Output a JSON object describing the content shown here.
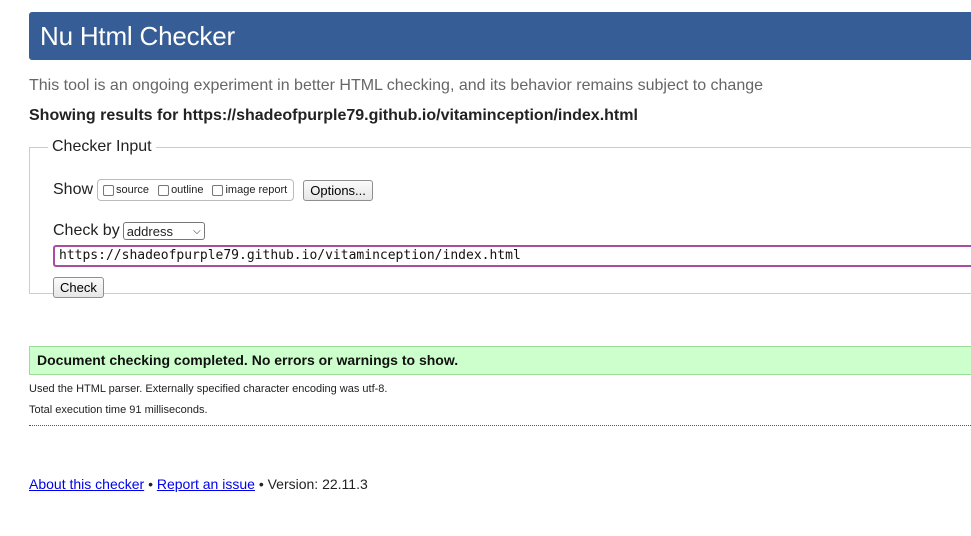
{
  "header": {
    "title": "Nu Html Checker"
  },
  "intro": {
    "text": "This tool is an ongoing experiment in better HTML checking, and its behavior remains subject to change"
  },
  "showing": {
    "text": "Showing results for https://shadeofpurple79.github.io/vitaminception/index.html"
  },
  "checker_input": {
    "legend": "Checker Input",
    "show_label": "Show",
    "options": [
      {
        "label": "source",
        "checked": false
      },
      {
        "label": "outline",
        "checked": false
      },
      {
        "label": "image report",
        "checked": false
      }
    ],
    "options_button": "Options...",
    "check_by_label": "Check by",
    "check_by_value": "address",
    "url_value": "https://shadeofpurple79.github.io/vitaminception/index.html",
    "check_button": "Check"
  },
  "result": {
    "message": "Document checking completed. No errors or warnings to show.",
    "parser_info": "Used the HTML parser. Externally specified character encoding was utf-8.",
    "execution_time": "Total execution time 91 milliseconds."
  },
  "footer": {
    "about_link": "About this checker",
    "separator": "•",
    "report_link": "Report an issue",
    "version": "Version: 22.11.3"
  },
  "colors": {
    "header_bg": "#365d95",
    "success_bg": "#ccffcc",
    "input_border": "#a94d9e",
    "link": "#0000ee"
  }
}
